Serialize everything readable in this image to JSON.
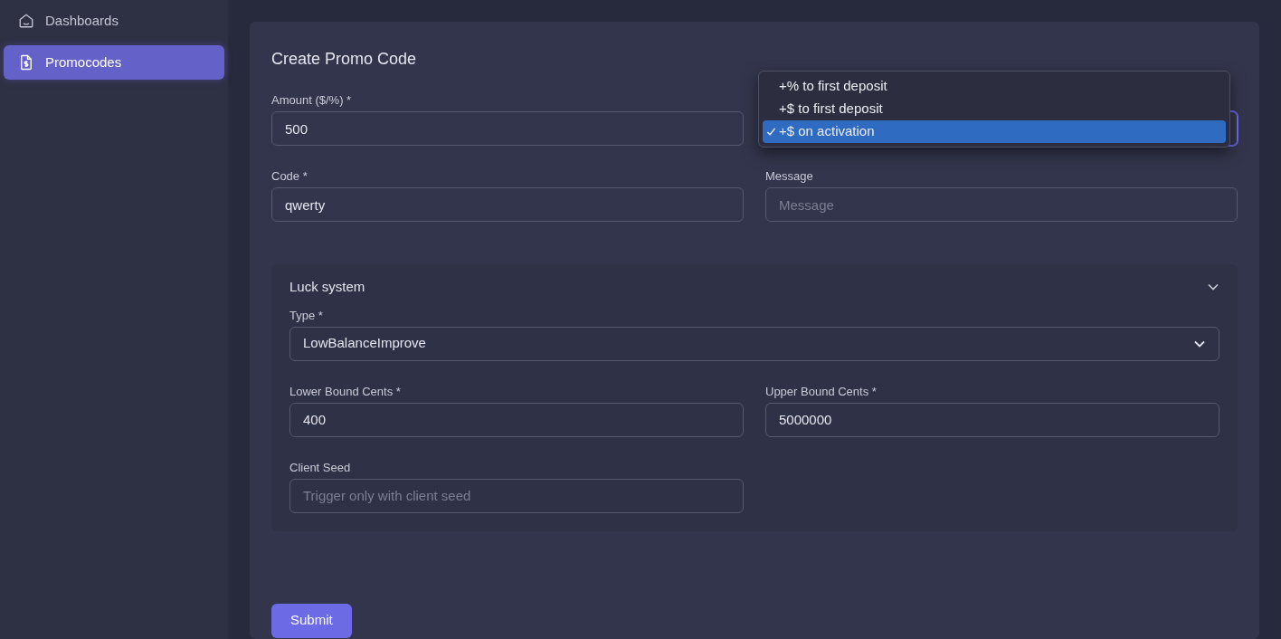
{
  "sidebar": {
    "items": [
      {
        "label": "Dashboards",
        "selected": false
      },
      {
        "label": "Promocodes",
        "selected": true
      }
    ]
  },
  "form": {
    "title": "Create Promo Code",
    "amount": {
      "label": "Amount ($/%) *",
      "value": "500"
    },
    "bonus_type": {
      "expanded": true,
      "options": [
        {
          "label": "+% to first deposit",
          "selected": false
        },
        {
          "label": "+$ to first deposit",
          "selected": false
        },
        {
          "label": "+$ on activation",
          "selected": true
        }
      ]
    },
    "code": {
      "label": "Code *",
      "value": "qwerty"
    },
    "message": {
      "label": "Message",
      "placeholder": "Message"
    },
    "luck_system": {
      "title": "Luck system",
      "expanded": true,
      "type": {
        "label": "Type *",
        "value": "LowBalanceImprove"
      },
      "lower_bound": {
        "label": "Lower Bound Cents *",
        "value": "400"
      },
      "upper_bound": {
        "label": "Upper Bound Cents *",
        "value": "5000000"
      },
      "client_seed": {
        "label": "Client Seed",
        "placeholder": "Trigger only with client seed"
      }
    },
    "submit": {
      "label": "Submit"
    }
  }
}
